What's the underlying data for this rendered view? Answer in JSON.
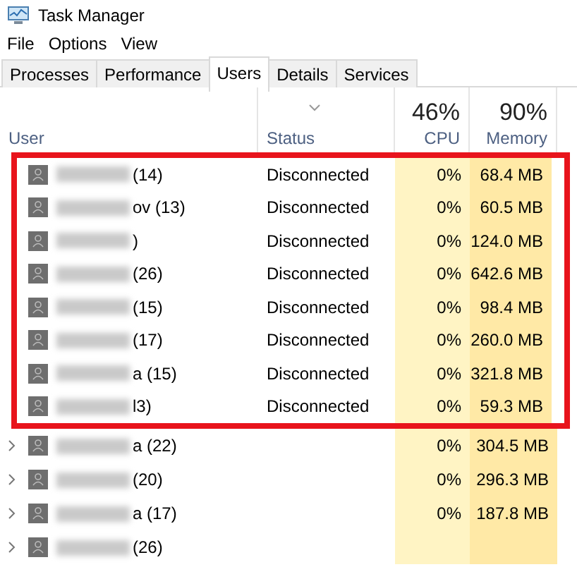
{
  "window": {
    "title": "Task Manager"
  },
  "menu": [
    "File",
    "Options",
    "View"
  ],
  "tabs": [
    {
      "label": "Processes",
      "selected": false
    },
    {
      "label": "Performance",
      "selected": false
    },
    {
      "label": "Users",
      "selected": true
    },
    {
      "label": "Details",
      "selected": false
    },
    {
      "label": "Services",
      "selected": false
    }
  ],
  "columns": {
    "user": "User",
    "status": "Status",
    "cpu_total": "46%",
    "cpu": "CPU",
    "memory_total": "90%",
    "memory": "Memory"
  },
  "rows": [
    {
      "user": "(14)",
      "status": "Disconnected",
      "cpu": "0%",
      "memory": "68.4 MB",
      "expandable": false,
      "highlighted": true
    },
    {
      "user": "ov (13)",
      "status": "Disconnected",
      "cpu": "0%",
      "memory": "60.5 MB",
      "expandable": false,
      "highlighted": true
    },
    {
      "user": ")",
      "status": "Disconnected",
      "cpu": "0%",
      "memory": "124.0 MB",
      "expandable": false,
      "highlighted": true
    },
    {
      "user": "(26)",
      "status": "Disconnected",
      "cpu": "0%",
      "memory": "642.6 MB",
      "expandable": false,
      "highlighted": true
    },
    {
      "user": "(15)",
      "status": "Disconnected",
      "cpu": "0%",
      "memory": "98.4 MB",
      "expandable": false,
      "highlighted": true
    },
    {
      "user": "(17)",
      "status": "Disconnected",
      "cpu": "0%",
      "memory": "260.0 MB",
      "expandable": false,
      "highlighted": true
    },
    {
      "user": "a (15)",
      "status": "Disconnected",
      "cpu": "0%",
      "memory": "321.8 MB",
      "expandable": false,
      "highlighted": true
    },
    {
      "user": "l3)",
      "status": "Disconnected",
      "cpu": "0%",
      "memory": "59.3 MB",
      "expandable": false,
      "highlighted": true
    },
    {
      "user": "a (22)",
      "cpu": "0%",
      "memory": "304.5 MB",
      "expandable": true,
      "highlighted": false
    },
    {
      "user": "(20)",
      "cpu": "0%",
      "memory": "296.3 MB",
      "expandable": true,
      "highlighted": false
    },
    {
      "user": "a (17)",
      "cpu": "0%",
      "memory": "187.8 MB",
      "expandable": true,
      "highlighted": false
    },
    {
      "user": "(26)",
      "expandable": true,
      "highlighted": false
    }
  ]
}
